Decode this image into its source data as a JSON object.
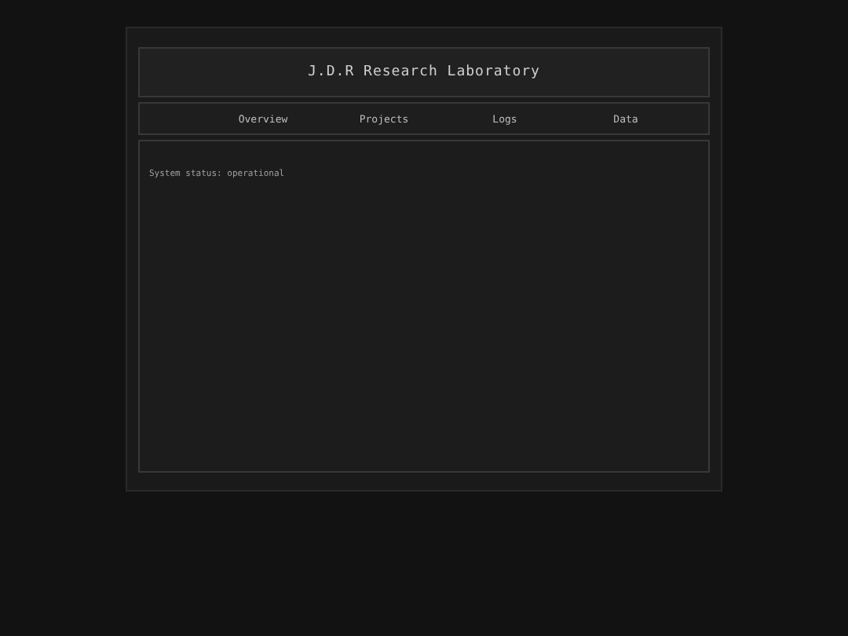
{
  "header": {
    "title": "J.D.R Research Laboratory"
  },
  "nav": [
    {
      "label": "Overview"
    },
    {
      "label": "Projects"
    },
    {
      "label": "Logs"
    },
    {
      "label": "Data"
    }
  ],
  "content": {
    "status": "System status: operational"
  }
}
